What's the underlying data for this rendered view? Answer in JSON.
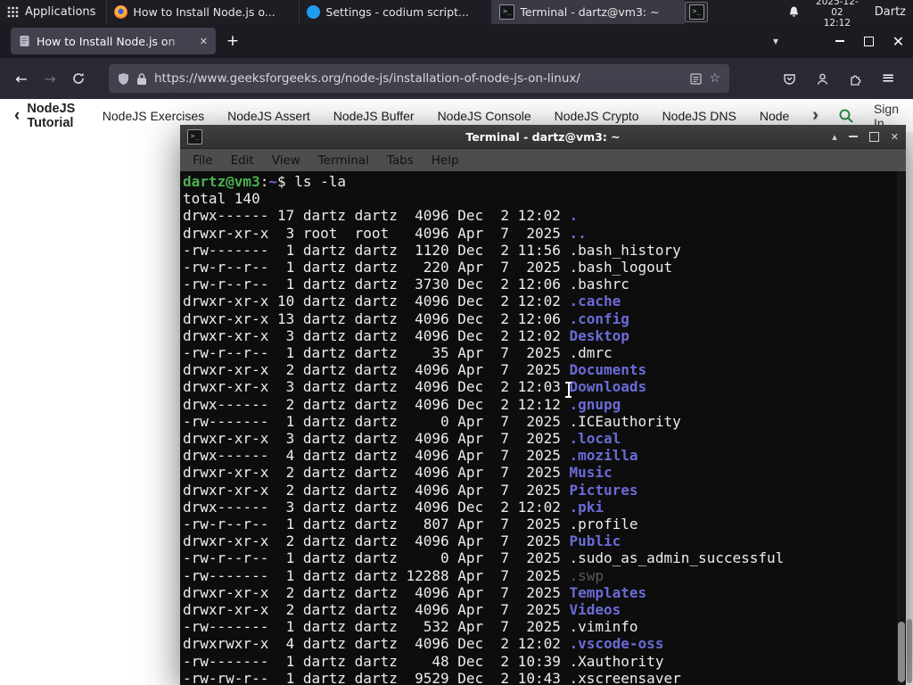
{
  "colors": {
    "accent_green": "#2f8d46",
    "term_dir": "#6b6bd8",
    "term_green": "#4CAF50",
    "term_dim": "#5a5a5a",
    "term_fg": "#ededed",
    "term_bg": "#0d0d0d"
  },
  "glyphs": {
    "close": "✕",
    "shade": "▴",
    "new_tab": "+",
    "tabs_chevron": "▾",
    "back": "←",
    "forward": "→",
    "menu": "≡",
    "star": "☆",
    "prev_chevron": "‹",
    "next_chevron": "›"
  },
  "panel": {
    "applications": "Applications",
    "tasks": [
      {
        "title": "How to Install Node.js o...",
        "icon": "firefox",
        "active": false
      },
      {
        "title": "Settings - codium script...",
        "icon": "codium",
        "active": false
      },
      {
        "title": "Terminal - dartz@vm3: ~",
        "icon": "terminal",
        "active": true
      }
    ],
    "date": "2025-12-02",
    "time": "12:12",
    "user": "Dartz"
  },
  "browser": {
    "tab_title": "How to Install Node.js on",
    "url": "https://www.geeksforgeeks.org/node-js/installation-of-node-js-on-linux/"
  },
  "site": {
    "back_item": "NodeJS Tutorial",
    "items": [
      "NodeJS Exercises",
      "NodeJS Assert",
      "NodeJS Buffer",
      "NodeJS Console",
      "NodeJS Crypto",
      "NodeJS DNS",
      "Node"
    ],
    "sign_in": "Sign In"
  },
  "terminal": {
    "title": "Terminal - dartz@vm3: ~",
    "menu": [
      "File",
      "Edit",
      "View",
      "Terminal",
      "Tabs",
      "Help"
    ],
    "prompt": {
      "userhost": "dartz@vm3",
      "colon": ":",
      "path": "~",
      "dollar": "$ "
    },
    "command": "ls -la",
    "total": "total 140",
    "rows": [
      {
        "pre": "drwx------ 17 dartz dartz  4096 Dec  2 12:02 ",
        "name": ".",
        "type": "dir"
      },
      {
        "pre": "drwxr-xr-x  3 root  root   4096 Apr  7  2025 ",
        "name": "..",
        "type": "dir"
      },
      {
        "pre": "-rw-------  1 dartz dartz  1120 Dec  2 11:56 ",
        "name": ".bash_history",
        "type": "file"
      },
      {
        "pre": "-rw-r--r--  1 dartz dartz   220 Apr  7  2025 ",
        "name": ".bash_logout",
        "type": "file"
      },
      {
        "pre": "-rw-r--r--  1 dartz dartz  3730 Dec  2 12:06 ",
        "name": ".bashrc",
        "type": "file"
      },
      {
        "pre": "drwxr-xr-x 10 dartz dartz  4096 Dec  2 12:02 ",
        "name": ".cache",
        "type": "dir"
      },
      {
        "pre": "drwxr-xr-x 13 dartz dartz  4096 Dec  2 12:06 ",
        "name": ".config",
        "type": "dir"
      },
      {
        "pre": "drwxr-xr-x  3 dartz dartz  4096 Dec  2 12:02 ",
        "name": "Desktop",
        "type": "dir"
      },
      {
        "pre": "-rw-r--r--  1 dartz dartz    35 Apr  7  2025 ",
        "name": ".dmrc",
        "type": "file"
      },
      {
        "pre": "drwxr-xr-x  2 dartz dartz  4096 Apr  7  2025 ",
        "name": "Documents",
        "type": "dir"
      },
      {
        "pre": "drwxr-xr-x  3 dartz dartz  4096 Dec  2 12:03 ",
        "name": "Downloads",
        "type": "dir"
      },
      {
        "pre": "drwx------  2 dartz dartz  4096 Dec  2 12:12 ",
        "name": ".gnupg",
        "type": "dir"
      },
      {
        "pre": "-rw-------  1 dartz dartz     0 Apr  7  2025 ",
        "name": ".ICEauthority",
        "type": "file"
      },
      {
        "pre": "drwxr-xr-x  3 dartz dartz  4096 Apr  7  2025 ",
        "name": ".local",
        "type": "dir"
      },
      {
        "pre": "drwx------  4 dartz dartz  4096 Apr  7  2025 ",
        "name": ".mozilla",
        "type": "dir"
      },
      {
        "pre": "drwxr-xr-x  2 dartz dartz  4096 Apr  7  2025 ",
        "name": "Music",
        "type": "dir"
      },
      {
        "pre": "drwxr-xr-x  2 dartz dartz  4096 Apr  7  2025 ",
        "name": "Pictures",
        "type": "dir"
      },
      {
        "pre": "drwx------  3 dartz dartz  4096 Dec  2 12:02 ",
        "name": ".pki",
        "type": "dir"
      },
      {
        "pre": "-rw-r--r--  1 dartz dartz   807 Apr  7  2025 ",
        "name": ".profile",
        "type": "file"
      },
      {
        "pre": "drwxr-xr-x  2 dartz dartz  4096 Apr  7  2025 ",
        "name": "Public",
        "type": "dir"
      },
      {
        "pre": "-rw-r--r--  1 dartz dartz     0 Apr  7  2025 ",
        "name": ".sudo_as_admin_successful",
        "type": "file"
      },
      {
        "pre": "-rw-------  1 dartz dartz 12288 Apr  7  2025 ",
        "name": ".swp",
        "type": "dim"
      },
      {
        "pre": "drwxr-xr-x  2 dartz dartz  4096 Apr  7  2025 ",
        "name": "Templates",
        "type": "dir"
      },
      {
        "pre": "drwxr-xr-x  2 dartz dartz  4096 Apr  7  2025 ",
        "name": "Videos",
        "type": "dir"
      },
      {
        "pre": "-rw-------  1 dartz dartz   532 Apr  7  2025 ",
        "name": ".viminfo",
        "type": "file"
      },
      {
        "pre": "drwxrwxr-x  4 dartz dartz  4096 Dec  2 12:02 ",
        "name": ".vscode-oss",
        "type": "dir"
      },
      {
        "pre": "-rw-------  1 dartz dartz    48 Dec  2 10:39 ",
        "name": ".Xauthority",
        "type": "file"
      },
      {
        "pre": "-rw-rw-r--  1 dartz dartz  9529 Dec  2 10:43 ",
        "name": ".xscreensaver",
        "type": "file"
      }
    ]
  }
}
